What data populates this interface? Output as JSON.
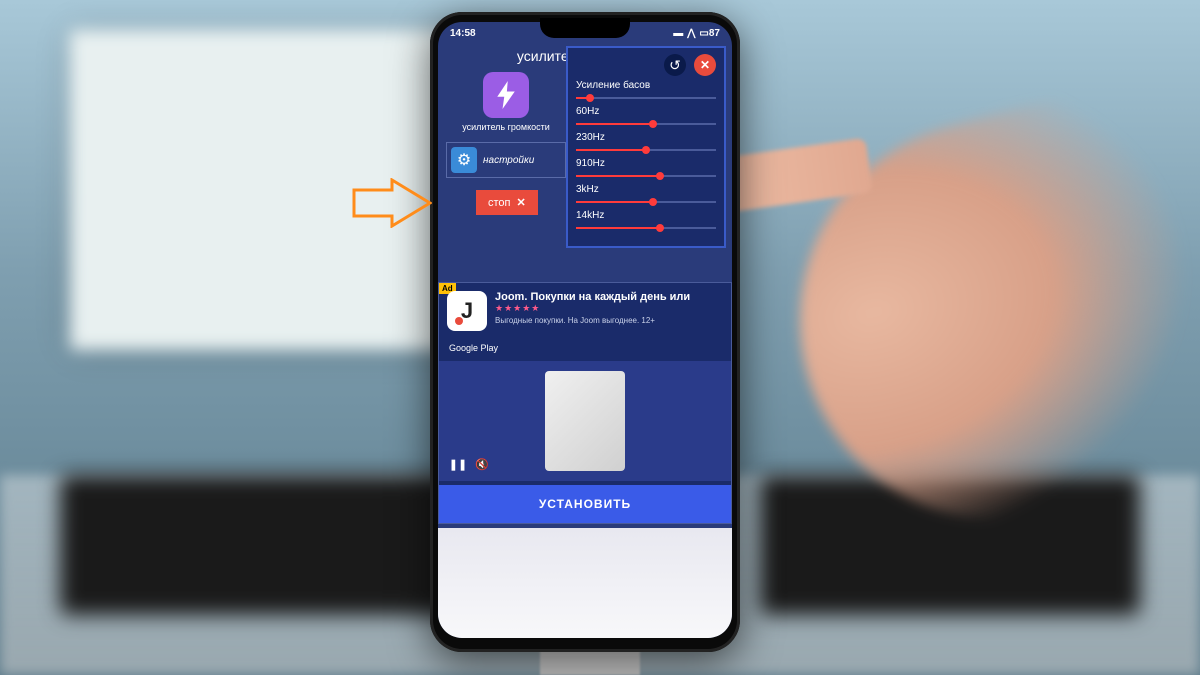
{
  "statusbar": {
    "time": "14:58",
    "battery_pct": "87"
  },
  "app_title": "усилитель громкости",
  "volume_booster_label": "усилитель громкости",
  "settings_label": "настройки",
  "stop_label": "стоп",
  "eq": {
    "bands": [
      {
        "label": "Усиление басов",
        "value": 10
      },
      {
        "label": "60Hz",
        "value": 55
      },
      {
        "label": "230Hz",
        "value": 50
      },
      {
        "label": "910Hz",
        "value": 60
      },
      {
        "label": "3kHz",
        "value": 55
      },
      {
        "label": "14kHz",
        "value": 60
      }
    ]
  },
  "ad": {
    "badge": "Ad",
    "title": "Joom. Покупки на каждый день или",
    "stars": "★★★★★",
    "subtitle": "Выгодные покупки. На Joom выгоднее. 12+",
    "store": "Google Play",
    "install": "УСТАНОВИТЬ"
  },
  "colors": {
    "accent_red": "#e94b3c",
    "slider_red": "#ff3b3b",
    "app_bg": "#2a3b7a",
    "panel_bg": "#1a2b6a",
    "install_blue": "#3a5be8",
    "arrow_orange": "#ff8c1a"
  }
}
